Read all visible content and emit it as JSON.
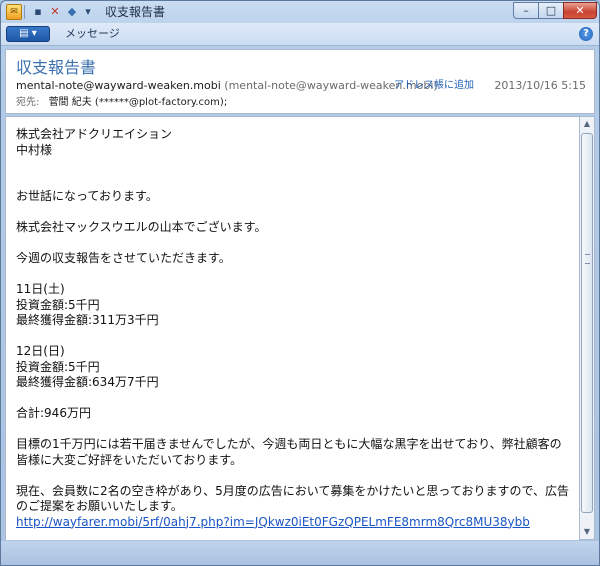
{
  "window": {
    "title": "収支報告書",
    "controls": {
      "minimize": "–",
      "maximize": "□",
      "close": "✕"
    }
  },
  "quick_access": [
    {
      "name": "save-icon",
      "glyph": "▪"
    },
    {
      "name": "delete-icon",
      "glyph": "✕"
    },
    {
      "name": "move-icon",
      "glyph": "◆"
    },
    {
      "name": "customize-icon",
      "glyph": "▾"
    }
  ],
  "ribbon": {
    "office_button": "▤ ▾",
    "tab_message": "メッセージ",
    "help": "?"
  },
  "header": {
    "subject": "収支報告書",
    "from_name": "mental-note@wayward-weaken.mobi",
    "from_address": "(mental-note@wayward-weaken.mobi)",
    "add_to_contacts": "アドレス帳に追加",
    "sent": "2013/10/16 5:15",
    "to_label": "宛先:",
    "to_value": "菅間 紀夫 (******@plot-factory.com);"
  },
  "message": {
    "lines": [
      "株式会社アドクリエイション",
      "中村様",
      "",
      "",
      "お世話になっております。",
      "",
      "株式会社マックスウエルの山本でございます。",
      "",
      "今週の収支報告をさせていただきます。",
      "",
      "11日(土)",
      "投資金額:5千円",
      "最終獲得金額:311万3千円",
      "",
      "12日(日)",
      "投資金額:5千円",
      "最終獲得金額:634万7千円",
      "",
      "合計:946万円",
      "",
      "目標の1千万円には若干届きませんでしたが、今週も両日ともに大幅な黒字を出せており、弊社顧客の",
      "皆様に大変ご好評をいただいております。",
      "",
      "現在、会員数に2名の空き枠があり、5月度の広告において募集をかけたいと思っておりますので、広告",
      "のご提案をお願いいたします。"
    ],
    "link": "http://wayfarer.mobi/5rf/0ahj7.php?im=JQkwz0iEt0FGzQPELmFE8mrm8Qrc8MU38ybb"
  },
  "scrollbar": {
    "up": "▲",
    "down": "▼"
  }
}
